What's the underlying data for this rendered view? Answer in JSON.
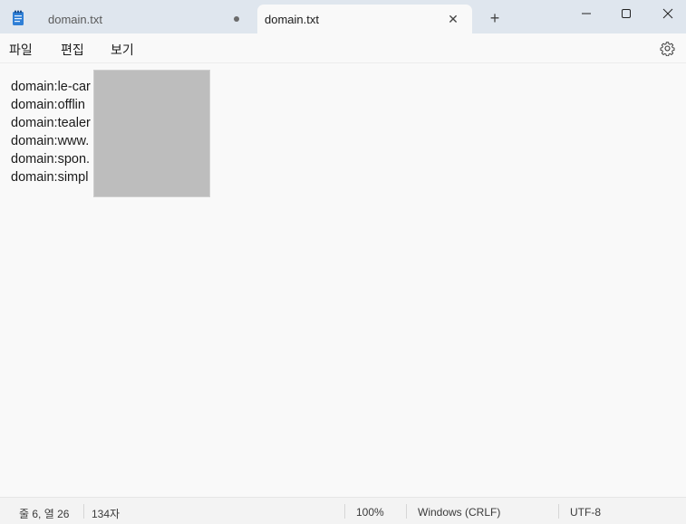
{
  "tabs": [
    {
      "title": "domain.txt",
      "unsaved": true
    },
    {
      "title": "domain.txt",
      "active": true
    }
  ],
  "menu": [
    "파일",
    "편집",
    "보기"
  ],
  "editor": {
    "lines": [
      "domain:le-car",
      "domain:offlin",
      "domain:tealer",
      "domain:www.",
      "domain:spon.",
      "domain:simpl"
    ]
  },
  "status": {
    "position": "줄 6, 열 26",
    "chars": "134자",
    "zoom": "100%",
    "line_ending": "Windows (CRLF)",
    "encoding": "UTF-8"
  },
  "icons": {
    "app": "notepad-icon",
    "close_tab": "close-icon",
    "new_tab": "plus-icon",
    "minimize": "minimize-icon",
    "maximize": "maximize-icon",
    "close_window": "close-icon",
    "settings": "gear-icon"
  },
  "colors": {
    "titlebar": "#dfe6ee",
    "editor_bg": "#f9f9f9",
    "app_icon": "#2f7fd6"
  }
}
